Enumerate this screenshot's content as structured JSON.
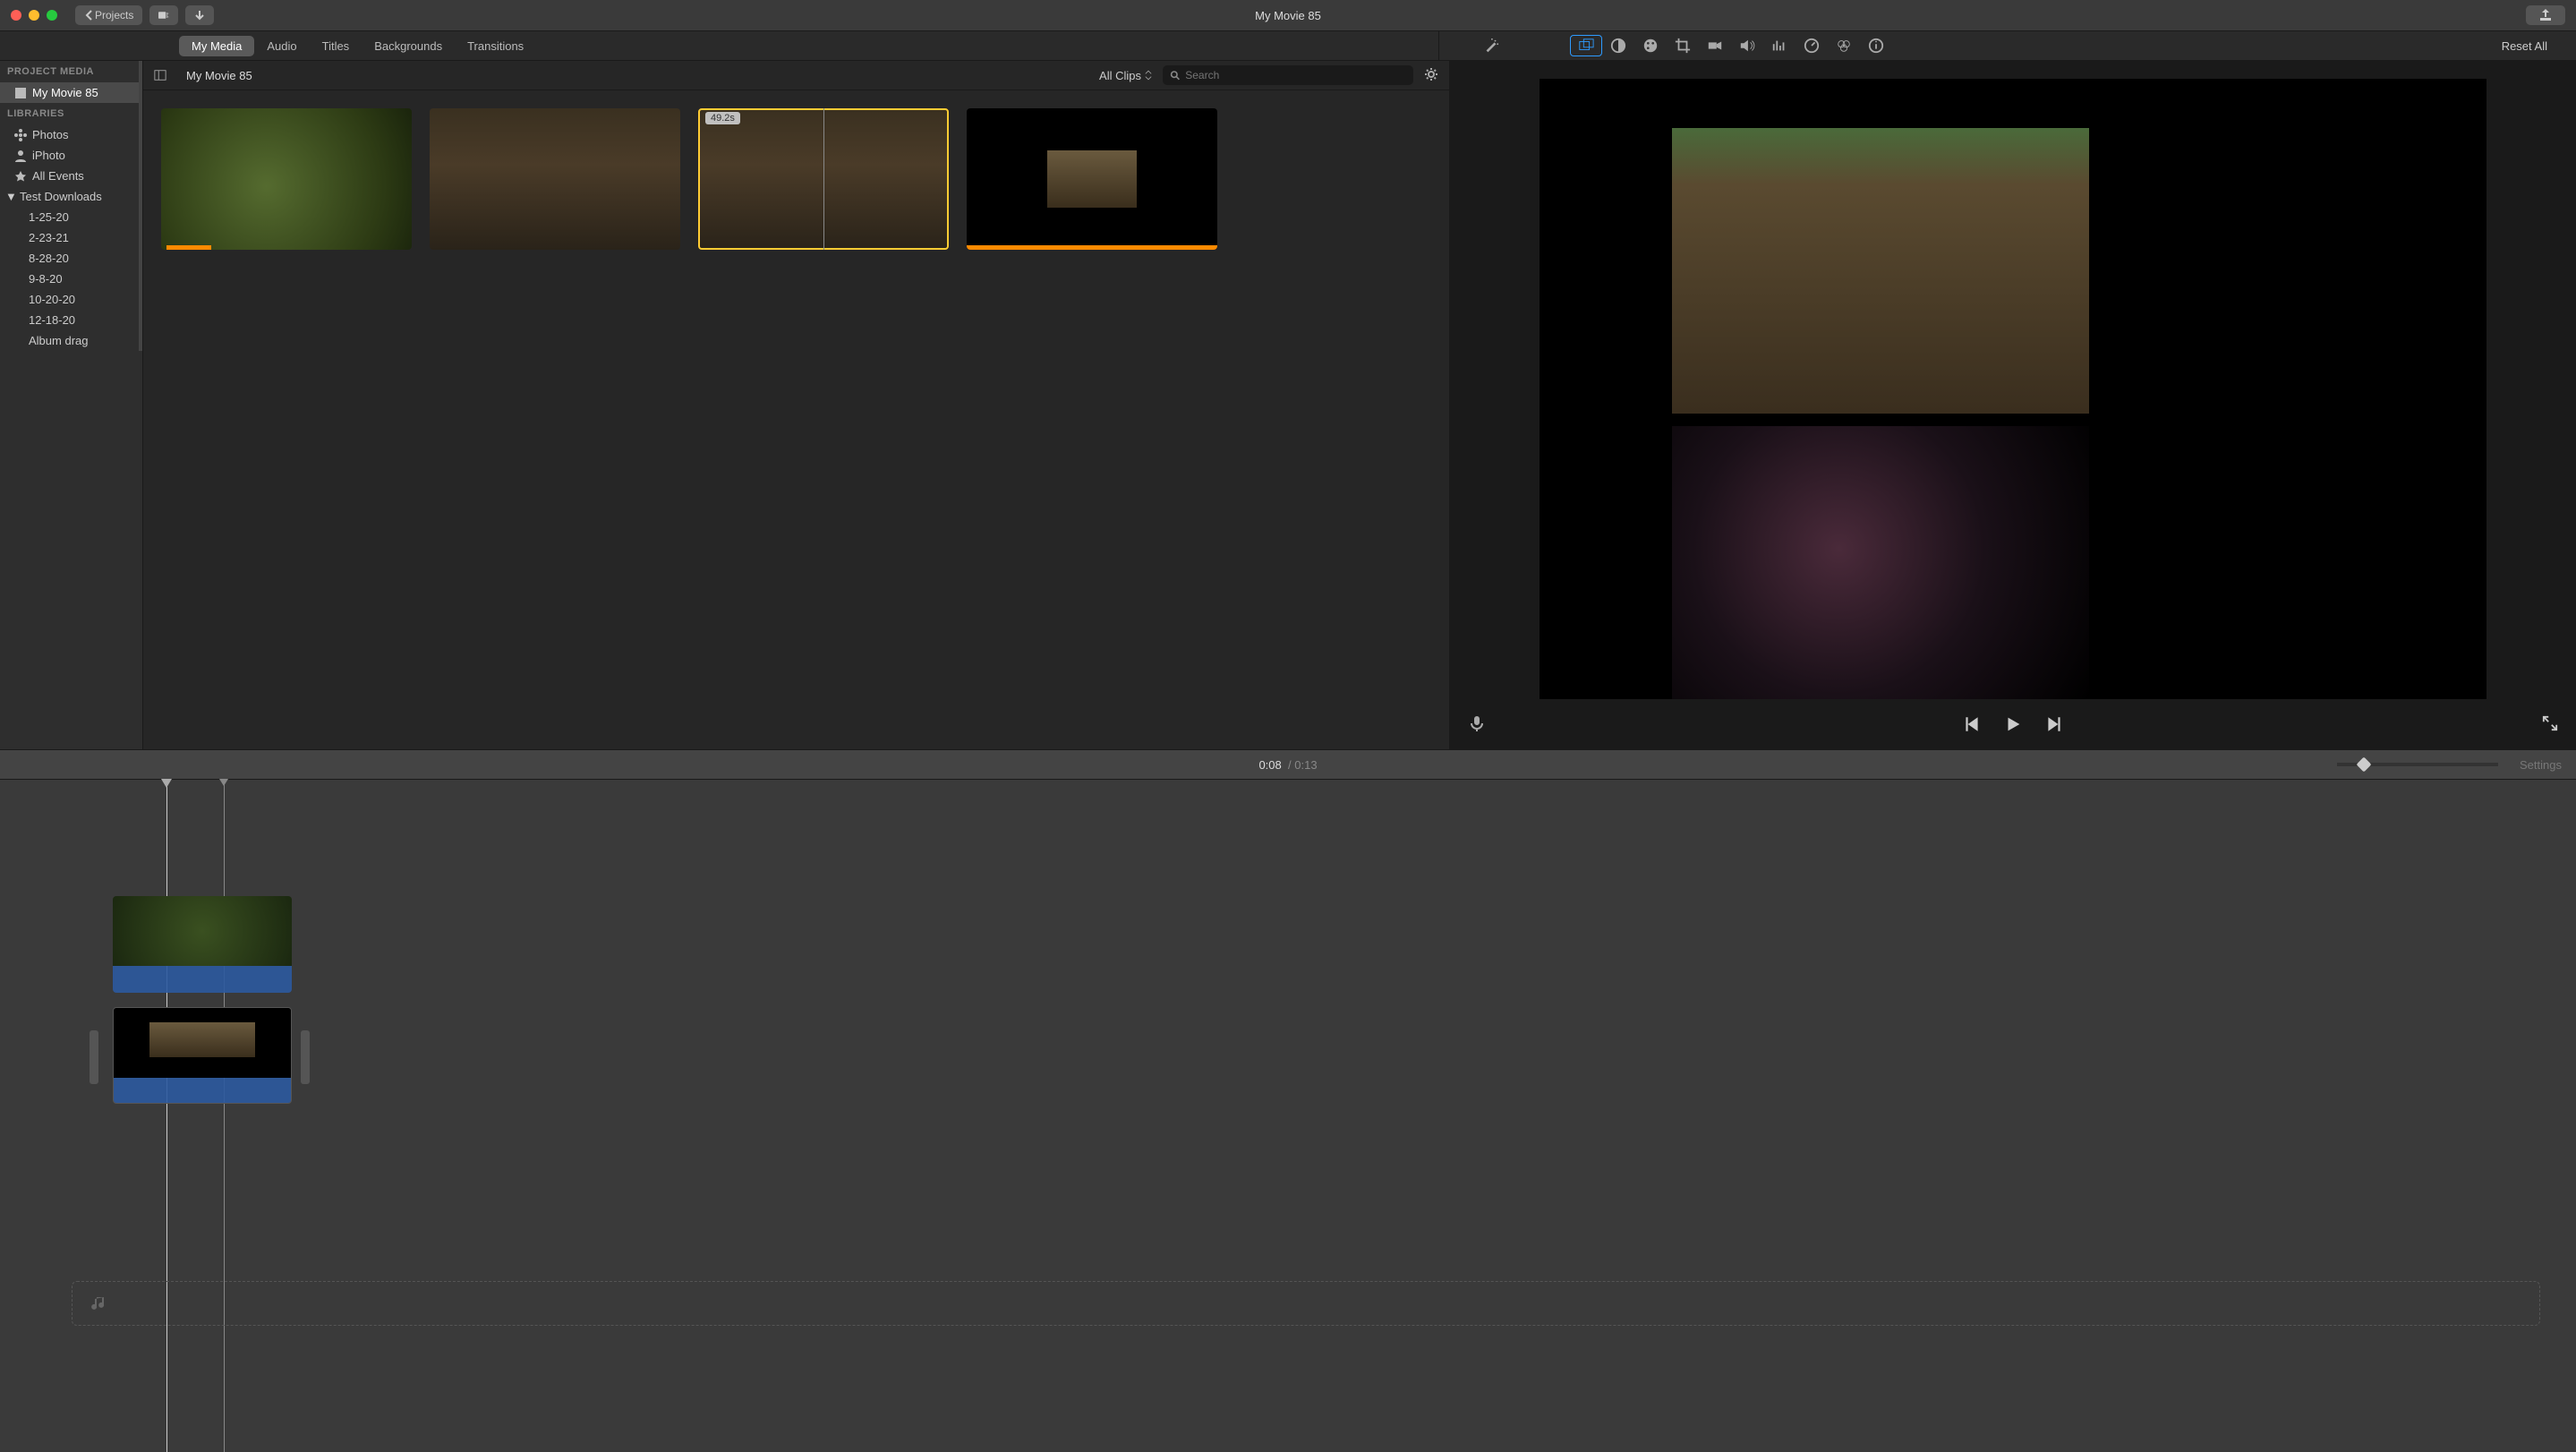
{
  "titlebar": {
    "projects_label": "Projects",
    "title": "My Movie 85"
  },
  "tabs": {
    "items": [
      "My Media",
      "Audio",
      "Titles",
      "Backgrounds",
      "Transitions"
    ],
    "active_index": 0,
    "reset_all": "Reset All"
  },
  "sidebar": {
    "project_media_header": "PROJECT MEDIA",
    "project_items": [
      {
        "label": "My Movie 85",
        "selected": true
      }
    ],
    "libraries_header": "LIBRARIES",
    "library_items": [
      {
        "label": "Photos",
        "icon": "flower"
      },
      {
        "label": "iPhoto",
        "icon": "person"
      },
      {
        "label": "All Events",
        "icon": "star"
      },
      {
        "label": "Test Downloads",
        "icon": "disclosure-open",
        "expandable": true
      }
    ],
    "event_children": [
      "1-25-20",
      "2-23-21",
      "8-28-20",
      "9-8-20",
      "10-20-20",
      "12-18-20",
      "Album drag"
    ]
  },
  "browser": {
    "title": "My Movie 85",
    "filter_label": "All Clips",
    "search_placeholder": "Search",
    "clips": [
      {
        "kind": "abstract-green",
        "orange_marker": "partial"
      },
      {
        "kind": "river"
      },
      {
        "kind": "river",
        "selected": true,
        "duration_badge": "49.2s",
        "playhead": true
      },
      {
        "kind": "black-river-inset",
        "orange_marker": "full"
      }
    ]
  },
  "viewer": {
    "icons": [
      "overlay",
      "color-balance",
      "color-correct",
      "crop",
      "stabilize",
      "volume",
      "noise-eq",
      "speed",
      "clip-filter",
      "info"
    ],
    "active_icon_index": 0
  },
  "timebar": {
    "current": "0:08",
    "separator": "/",
    "duration": "0:13",
    "settings_label": "Settings"
  }
}
